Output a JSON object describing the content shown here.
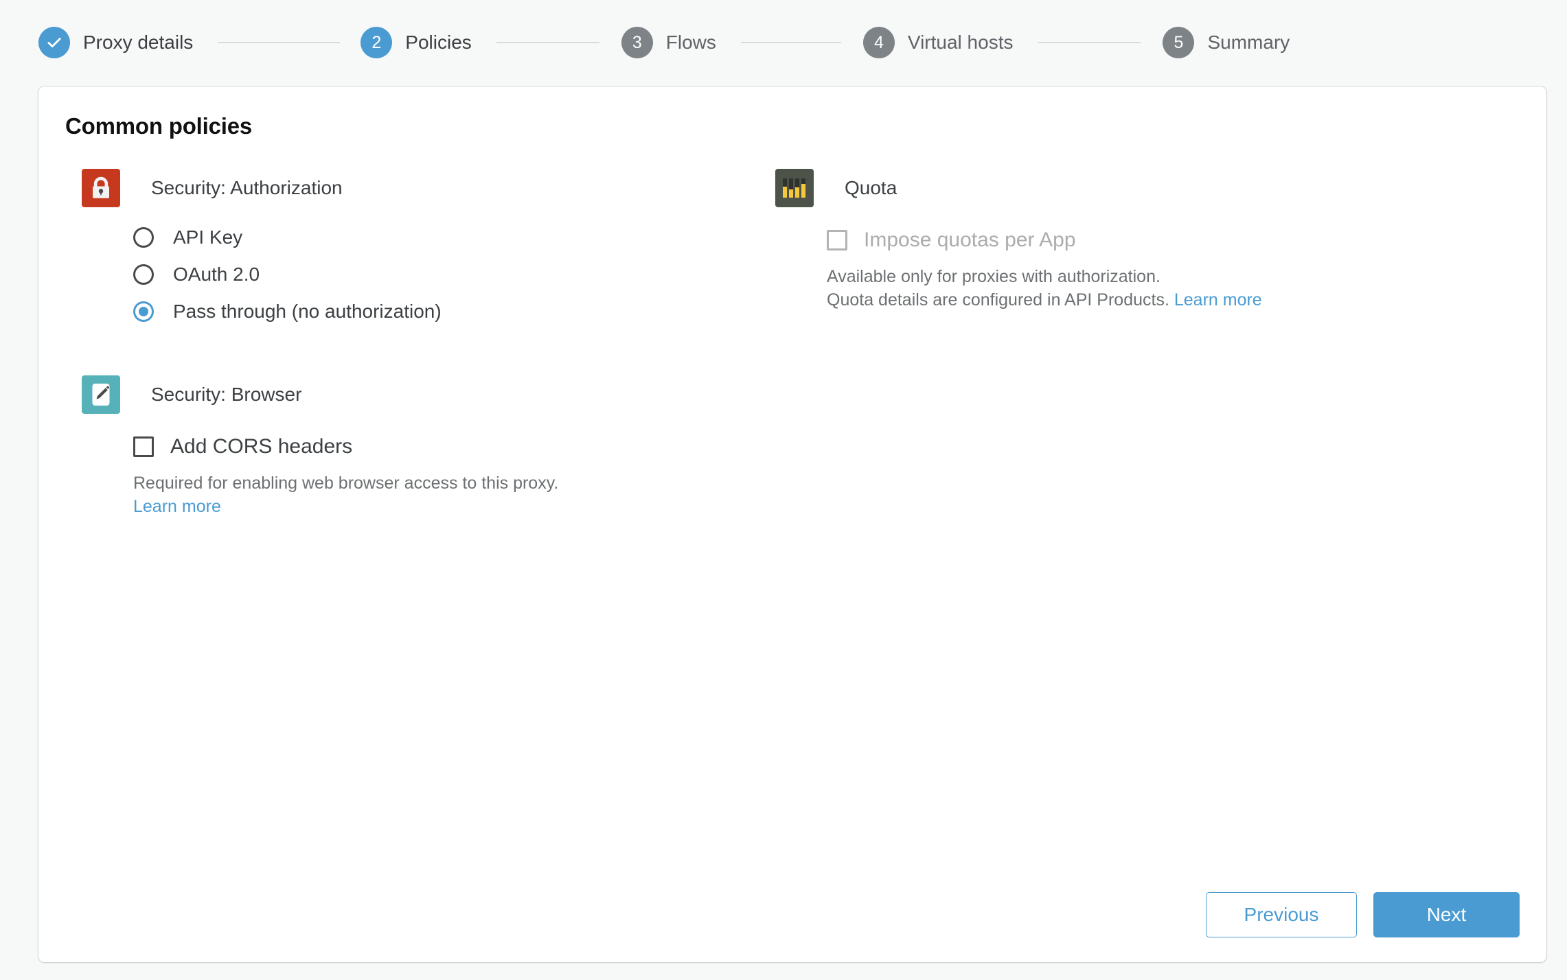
{
  "stepper": {
    "steps": [
      {
        "num": "1",
        "label": "Proxy details",
        "state": "done",
        "icon": "check-icon"
      },
      {
        "num": "2",
        "label": "Policies",
        "state": "current",
        "icon": ""
      },
      {
        "num": "3",
        "label": "Flows",
        "state": "pending",
        "icon": ""
      },
      {
        "num": "4",
        "label": "Virtual hosts",
        "state": "pending",
        "icon": ""
      },
      {
        "num": "5",
        "label": "Summary",
        "state": "pending",
        "icon": ""
      }
    ]
  },
  "card": {
    "title": "Common policies"
  },
  "authorization": {
    "icon": "lock-icon",
    "name": "Security: Authorization",
    "options": [
      {
        "label": "API Key",
        "checked": false
      },
      {
        "label": "OAuth 2.0",
        "checked": false
      },
      {
        "label": "Pass through (no authorization)",
        "checked": true
      }
    ]
  },
  "browser": {
    "icon": "pencil-icon",
    "name": "Security: Browser",
    "checkbox_label": "Add CORS headers",
    "checked": false,
    "helper_text": "Required for enabling web browser access to this proxy.",
    "learn_more": "Learn more"
  },
  "quota": {
    "icon": "quota-bars-icon",
    "name": "Quota",
    "checkbox_label": "Impose quotas per App",
    "checked": false,
    "disabled": true,
    "helper_line_1": "Available only for proxies with authorization.",
    "helper_line_2": "Quota details are configured in API Products. ",
    "learn_more": "Learn more"
  },
  "footer": {
    "previous_label": "Previous",
    "next_label": "Next"
  },
  "colors": {
    "accent_blue": "#4a9bd1",
    "lock_red": "#c7391f",
    "browser_teal": "#56b2b8",
    "quota_dark": "#4e5349",
    "quota_yellow": "#f4c73c",
    "page_bg": "#f7f8f8",
    "pending_gray": "#7d8387",
    "disabled_gray": "#acacac"
  }
}
